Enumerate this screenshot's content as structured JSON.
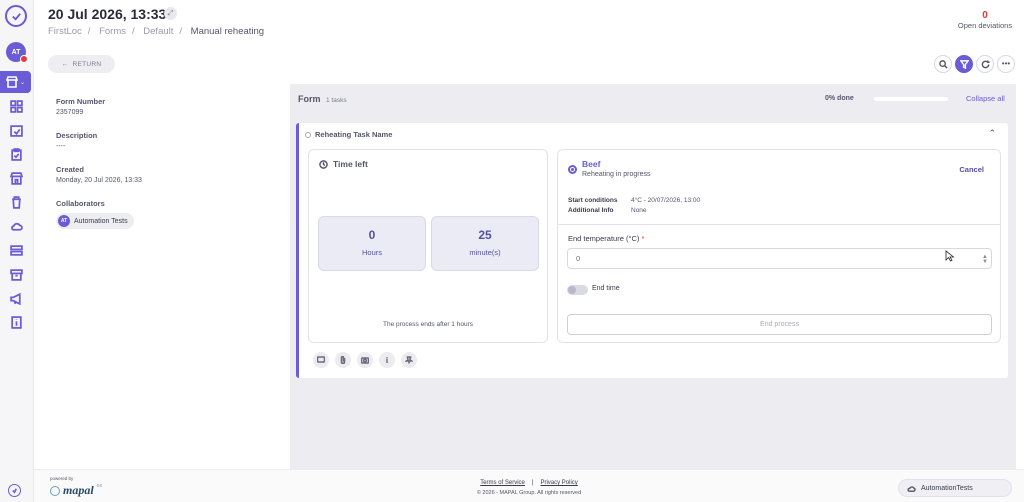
{
  "header": {
    "title": "20 Jul 2026, 13:33",
    "breadcrumb": [
      "FirstLoc",
      "Forms",
      "Default",
      "Manual reheating"
    ],
    "deviations_count": "0",
    "deviations_label": "Open deviations",
    "return_label": "RETURN"
  },
  "sidebar": {
    "avatar_initials": "AT",
    "items": [
      "dashboard-icon",
      "calendar-check-icon",
      "clipboard-icon",
      "store-icon",
      "trash-icon",
      "cloud-icon",
      "database-icon",
      "archive-icon",
      "megaphone-icon",
      "info-book-icon"
    ]
  },
  "details": {
    "form_number_label": "Form Number",
    "form_number": "2357099",
    "description_label": "Description",
    "description": "----",
    "created_label": "Created",
    "created": "Monday, 20 Jul 2026, 13:33",
    "collaborators_label": "Collaborators",
    "collaborator_initials": "AT",
    "collaborator_name": "Automation Tests"
  },
  "form": {
    "title": "Form",
    "tasks_count": "1 tasks",
    "progress_text": "0% done",
    "progress_fraction": 0.0,
    "collapse_all": "Collapse all",
    "task_name": "Reheating Task Name",
    "time_left_title": "Time left",
    "hours_value": "0",
    "hours_label": "Hours",
    "minutes_value": "25",
    "minutes_label": "minute(s)",
    "process_note": "The process ends after 1 hours",
    "item_name": "Beef",
    "item_status": "Reheating in progress",
    "cancel_label": "Cancel",
    "start_conditions_label": "Start conditions",
    "start_conditions_value": "4°C - 20/07/2026, 13:00",
    "additional_info_label": "Additional Info",
    "additional_info_value": "None",
    "end_temp_label": "End temperature (°C)",
    "end_temp_required": "*",
    "end_temp_placeholder": "0",
    "end_time_label": "End time",
    "end_process_label": "End process"
  },
  "footer": {
    "powered_by": "powered by",
    "brand": "mapal",
    "brand_suffix": "os",
    "terms": "Terms of Service",
    "separator": "|",
    "privacy": "Privacy Policy",
    "copyright": "© 2026 - MAPAL Group. All rights reserved",
    "account": "AutomationTests"
  },
  "colors": {
    "accent": "#6a5bd6",
    "deviation": "#e53935",
    "panel_bg": "#ededf1"
  }
}
